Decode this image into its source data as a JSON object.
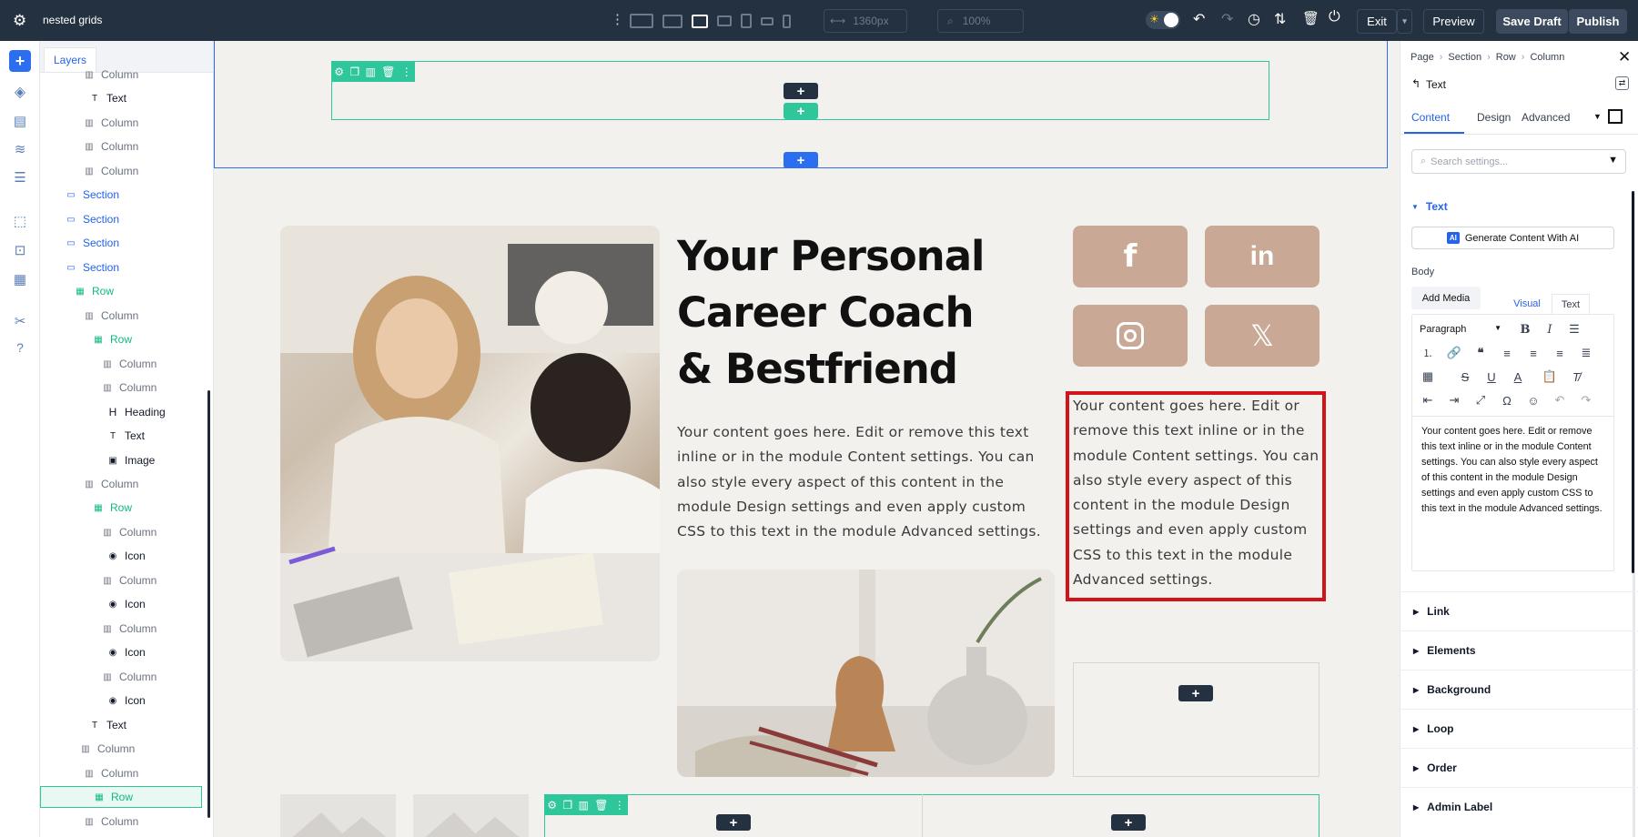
{
  "topbar": {
    "title": "nested grids",
    "width_value": "1360px",
    "zoom_value": "100%",
    "exit_label": "Exit",
    "preview_label": "Preview",
    "save_draft_label": "Save Draft",
    "publish_label": "Publish",
    "device_icons": [
      "desktop-wide-icon",
      "desktop-icon",
      "laptop-icon",
      "tablet-landscape-icon",
      "tablet-icon",
      "phone-landscape-icon",
      "phone-icon"
    ]
  },
  "rail": {
    "icons": [
      "add-icon",
      "layers-icon",
      "theme-builder-icon",
      "database-icon",
      "page-settings-icon",
      "wireframe-icon",
      "click-mode-icon",
      "portability-icon",
      "tools-icon",
      "help-icon"
    ]
  },
  "layers": {
    "tab_label": "Layers",
    "items": [
      {
        "label": "Column",
        "type": "col"
      },
      {
        "label": "Text",
        "type": "mod",
        "glyph": "T"
      },
      {
        "label": "Column",
        "type": "col"
      },
      {
        "label": "Column",
        "type": "col"
      },
      {
        "label": "Column",
        "type": "col"
      },
      {
        "label": "Section",
        "type": "sec"
      },
      {
        "label": "Section",
        "type": "sec"
      },
      {
        "label": "Section",
        "type": "sec"
      },
      {
        "label": "Section",
        "type": "sec"
      },
      {
        "label": "Row",
        "type": "row"
      },
      {
        "label": "Column",
        "type": "col"
      },
      {
        "label": "Row",
        "type": "row"
      },
      {
        "label": "Column",
        "type": "col"
      },
      {
        "label": "Column",
        "type": "col"
      },
      {
        "label": "Heading",
        "type": "mod",
        "glyph": "H"
      },
      {
        "label": "Text",
        "type": "mod",
        "glyph": "T"
      },
      {
        "label": "Image",
        "type": "mod",
        "glyph": "▣"
      },
      {
        "label": "Column",
        "type": "col"
      },
      {
        "label": "Row",
        "type": "row"
      },
      {
        "label": "Column",
        "type": "col"
      },
      {
        "label": "Icon",
        "type": "mod",
        "glyph": "◉"
      },
      {
        "label": "Column",
        "type": "col"
      },
      {
        "label": "Icon",
        "type": "mod",
        "glyph": "◉"
      },
      {
        "label": "Column",
        "type": "col"
      },
      {
        "label": "Icon",
        "type": "mod",
        "glyph": "◉"
      },
      {
        "label": "Column",
        "type": "col"
      },
      {
        "label": "Icon",
        "type": "mod",
        "glyph": "◉"
      },
      {
        "label": "Text",
        "type": "mod",
        "glyph": "T"
      },
      {
        "label": "Column",
        "type": "col"
      },
      {
        "label": "Column",
        "type": "col"
      },
      {
        "label": "Row",
        "type": "row"
      },
      {
        "label": "Column",
        "type": "col"
      }
    ]
  },
  "canvas": {
    "heading": "Your Personal Career Coach & Bestfriend",
    "body_text": "Your content goes here. Edit or remove this text inline or in the module Content settings. You can also style every aspect of this content in the module Design settings and even apply custom CSS to this text in the module Advanced settings.",
    "selected_text": "Your content goes here. Edit or remove this text inline or in the module Content settings. You can also style every aspect of this content in the module Design settings and even apply custom CSS to this text in the module Advanced settings.",
    "social": [
      "f",
      "in",
      "instagram",
      "X"
    ],
    "colors": {
      "accent_green": "#2fc69b",
      "accent_blue": "#2b6ef2",
      "social_bg": "#c9a996",
      "selection_red": "#d1131a",
      "dark": "#243141"
    }
  },
  "panel": {
    "breadcrumb": [
      "Page",
      "Section",
      "Row",
      "Column"
    ],
    "module_title": "Text",
    "tabs": [
      "Content",
      "Design",
      "Advanced"
    ],
    "search_placeholder": "Search settings...",
    "group_title": "Text",
    "ai_button": "Generate Content With AI",
    "ai_badge": "AI",
    "body_label": "Body",
    "add_media": "Add Media",
    "editor_tabs": [
      "Visual",
      "Text"
    ],
    "format_select": "Paragraph",
    "editor_text": "Your content goes here. Edit or remove this text inline or in the module Content settings. You can also style every aspect of this content in the module Design settings and even apply custom CSS to this text in the module Advanced settings.",
    "sections": [
      "Link",
      "Elements",
      "Background",
      "Loop",
      "Order",
      "Admin Label"
    ]
  }
}
